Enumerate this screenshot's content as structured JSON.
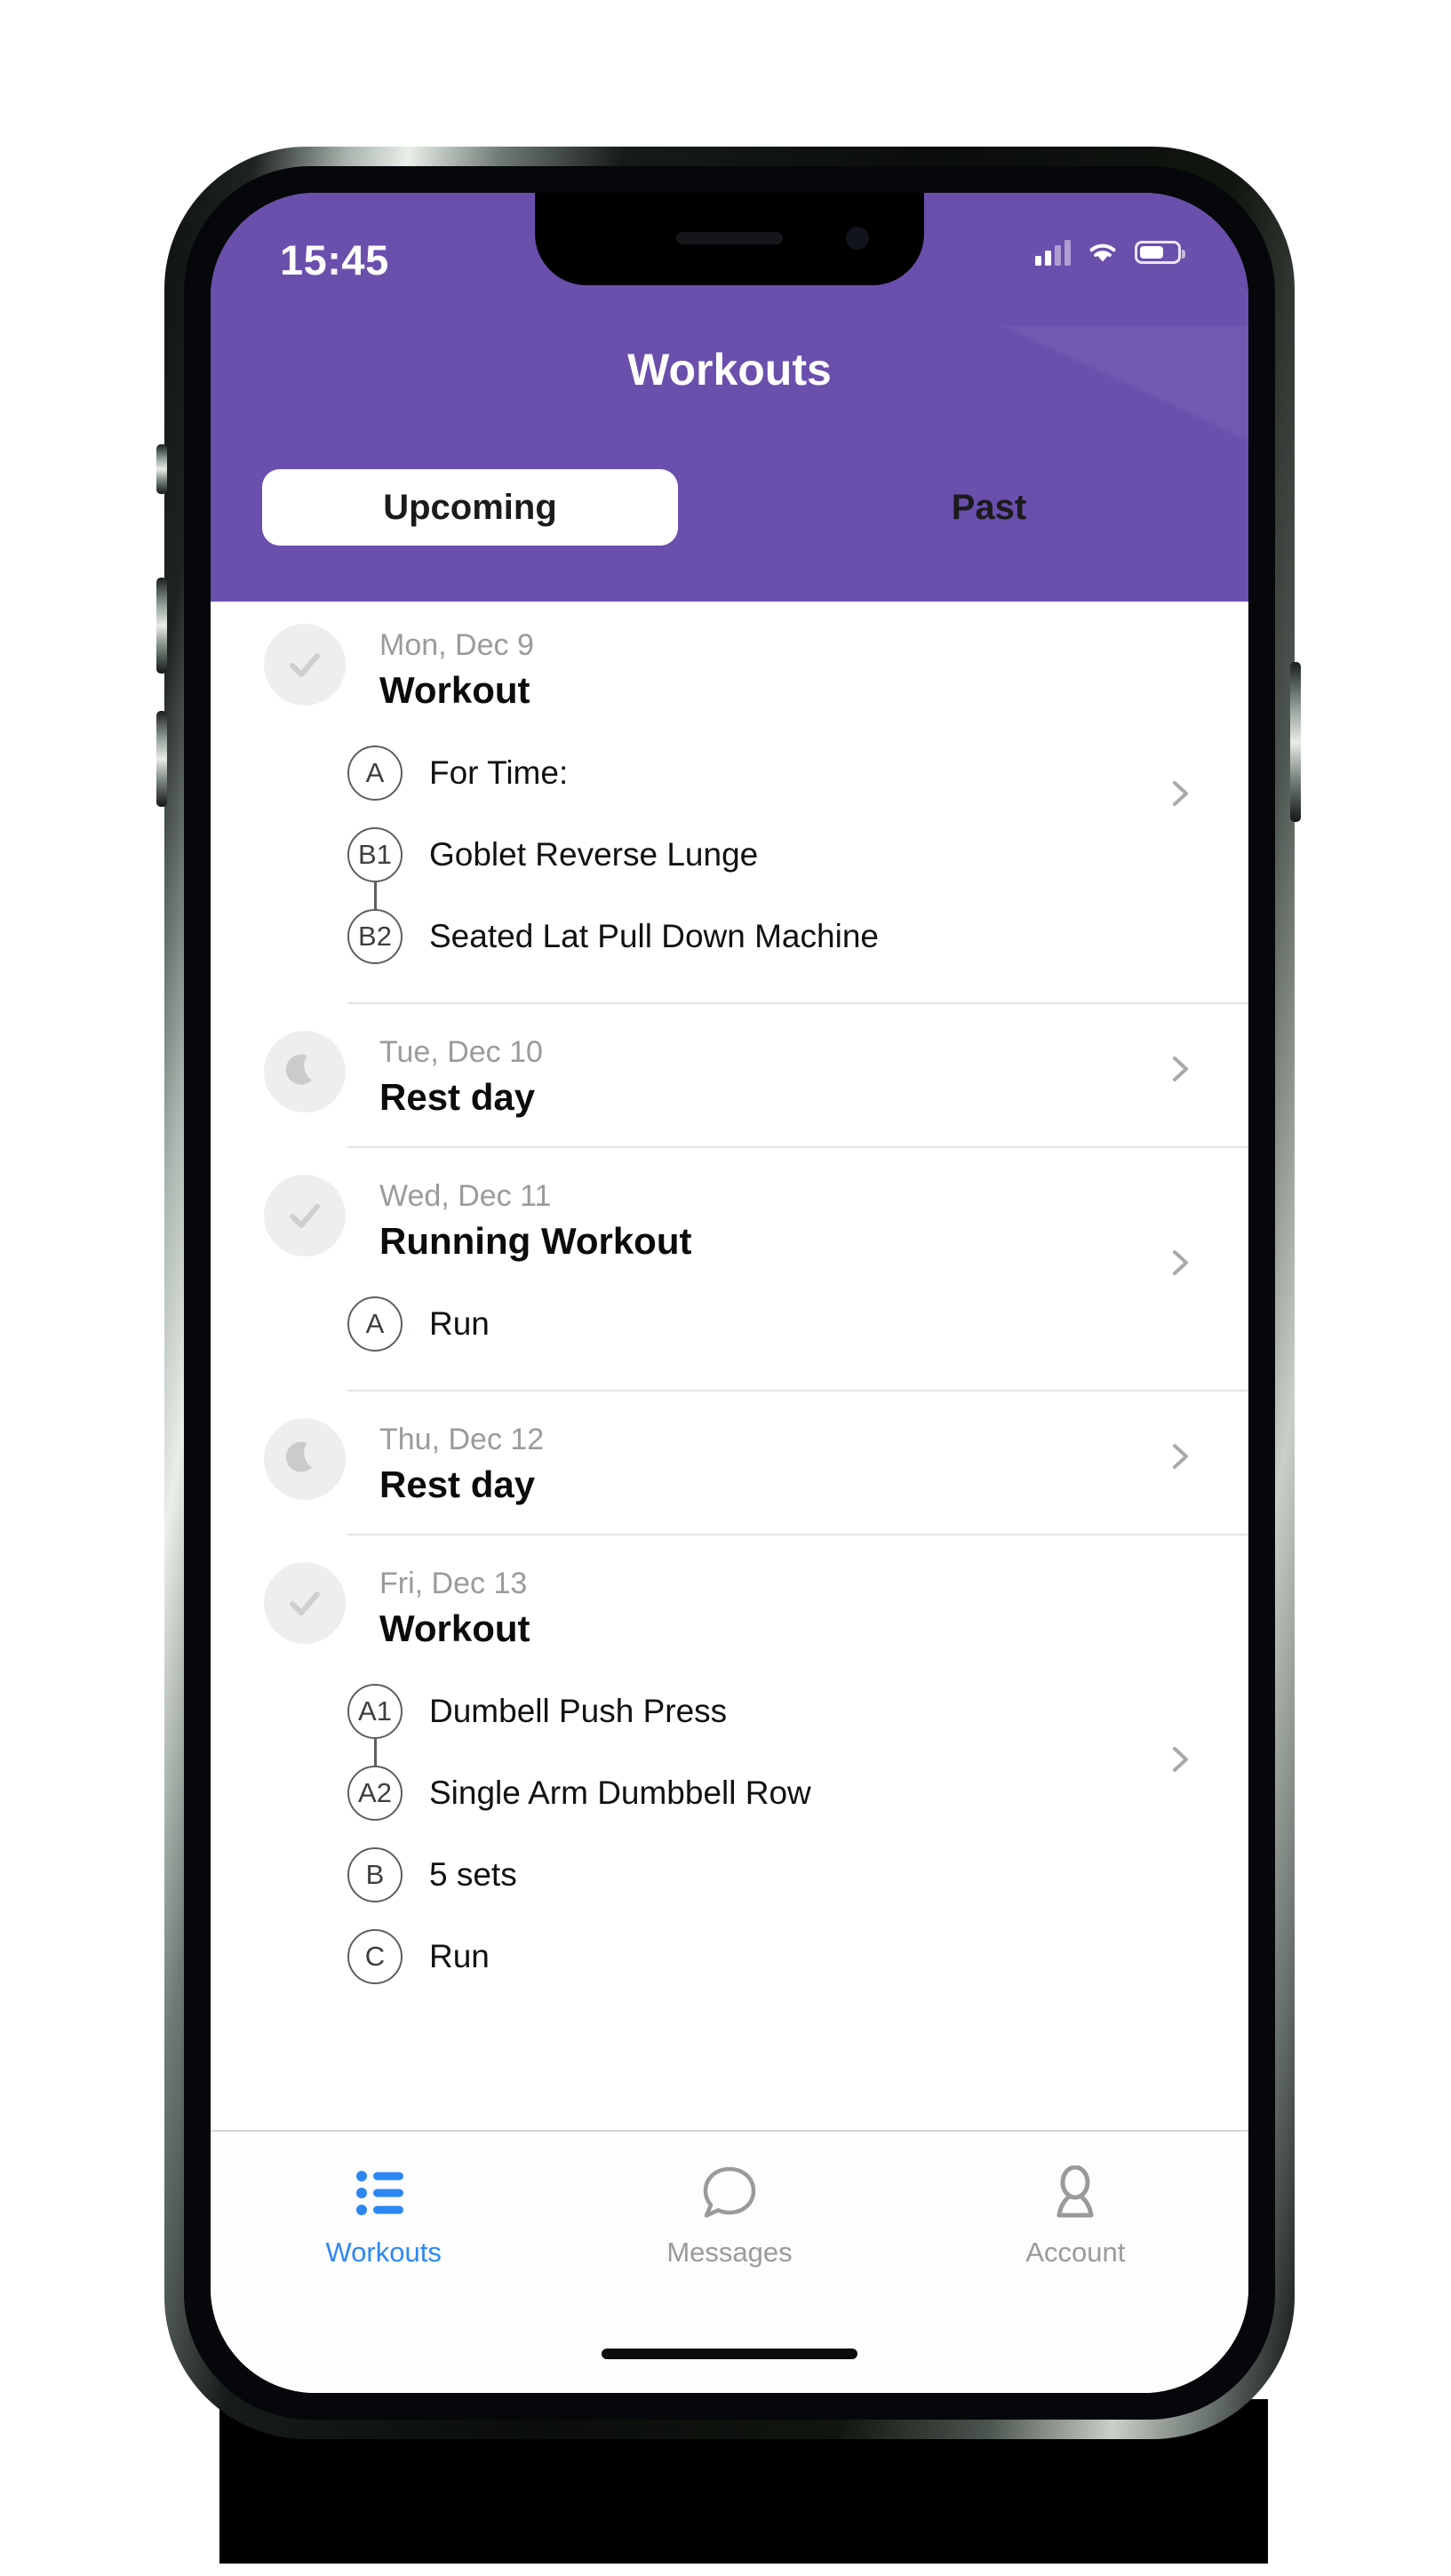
{
  "status_bar": {
    "time": "15:45",
    "cellular_icon": "cellular-signal-icon",
    "wifi_icon": "wifi-icon",
    "battery_icon": "battery-icon"
  },
  "header": {
    "title": "Workouts",
    "background_color": "#6a4fad",
    "tabs": [
      {
        "label": "Upcoming",
        "active": true
      },
      {
        "label": "Past",
        "active": false
      }
    ]
  },
  "days": [
    {
      "date": "Mon, Dec 9",
      "title": "Workout",
      "status_icon": "check-icon",
      "chevron": "chevron-right-icon",
      "items": [
        {
          "badge": "A",
          "label": "For Time:",
          "linked_to_next": false
        },
        {
          "badge": "B1",
          "label": "Goblet Reverse Lunge",
          "linked_to_next": true
        },
        {
          "badge": "B2",
          "label": "Seated Lat Pull Down Machine",
          "linked_to_next": false
        }
      ]
    },
    {
      "date": "Tue, Dec 10",
      "title": "Rest day",
      "status_icon": "moon-icon",
      "chevron": "chevron-right-icon",
      "items": []
    },
    {
      "date": "Wed, Dec 11",
      "title": "Running Workout",
      "status_icon": "check-icon",
      "chevron": "chevron-right-icon",
      "items": [
        {
          "badge": "A",
          "label": "Run",
          "linked_to_next": false
        }
      ]
    },
    {
      "date": "Thu, Dec 12",
      "title": "Rest day",
      "status_icon": "moon-icon",
      "chevron": "chevron-right-icon",
      "items": []
    },
    {
      "date": "Fri, Dec 13",
      "title": "Workout",
      "status_icon": "check-icon",
      "chevron": "chevron-right-icon",
      "items": [
        {
          "badge": "A1",
          "label": "Dumbell Push Press",
          "linked_to_next": true
        },
        {
          "badge": "A2",
          "label": "Single Arm Dumbbell Row",
          "linked_to_next": false
        },
        {
          "badge": "B",
          "label": "5 sets",
          "linked_to_next": false
        },
        {
          "badge": "C",
          "label": "Run",
          "linked_to_next": false
        }
      ]
    }
  ],
  "tab_bar": {
    "items": [
      {
        "label": "Workouts",
        "icon": "list-icon",
        "active": true,
        "color": "#2d87f3"
      },
      {
        "label": "Messages",
        "icon": "speech-bubble-icon",
        "active": false,
        "color": "#9a9a9a"
      },
      {
        "label": "Account",
        "icon": "person-icon",
        "active": false,
        "color": "#9a9a9a"
      }
    ]
  }
}
